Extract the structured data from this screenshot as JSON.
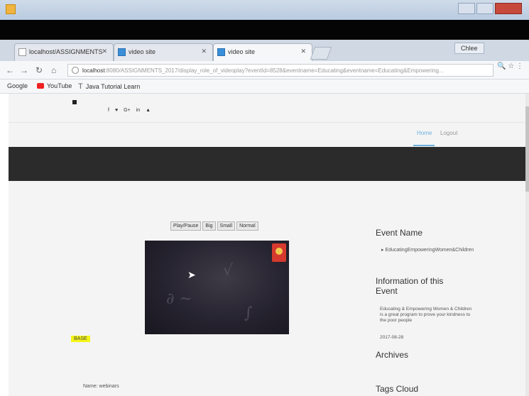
{
  "tabs": [
    {
      "label": "localhost/ASSIGNMENTS",
      "active": false
    },
    {
      "label": "video site",
      "active": false
    },
    {
      "label": "video site",
      "active": true
    }
  ],
  "user_badge": "Chlee",
  "address": {
    "host": "localhost",
    "path": ":8080/ASSIGNMENTS_2017/display_role_of_videoplay?eventId=8528&eventname=Educating&eventname=Educating&Empowering..."
  },
  "bookmarks": [
    "Google",
    "YouTube",
    "Java Tutorial Learn"
  ],
  "social_icons": [
    "f",
    "♥",
    "G+",
    "in",
    "▲"
  ],
  "nav": {
    "home": "Home",
    "logout": "Logout"
  },
  "controls": [
    "Play/Pause",
    "Big",
    "Small",
    "Normal"
  ],
  "highlight_tag": "BASE",
  "bottom_text": "Name: webinars",
  "sidebar": {
    "event_name_heading": "Event Name",
    "event_name_value": "▸ EducatingEmpoweringWomen&Children",
    "info_heading": "Information of this Event",
    "info_text": "Educating & Empowering Women & Children is a great program to prove your kindness to the poor people",
    "date": "2017-08-28",
    "archives_heading": "Archives",
    "tags_heading": "Tags Cloud"
  },
  "colors": {
    "accent": "#6ab0de",
    "dark_band": "#2b2b2b",
    "highlight": "#f5f516"
  }
}
